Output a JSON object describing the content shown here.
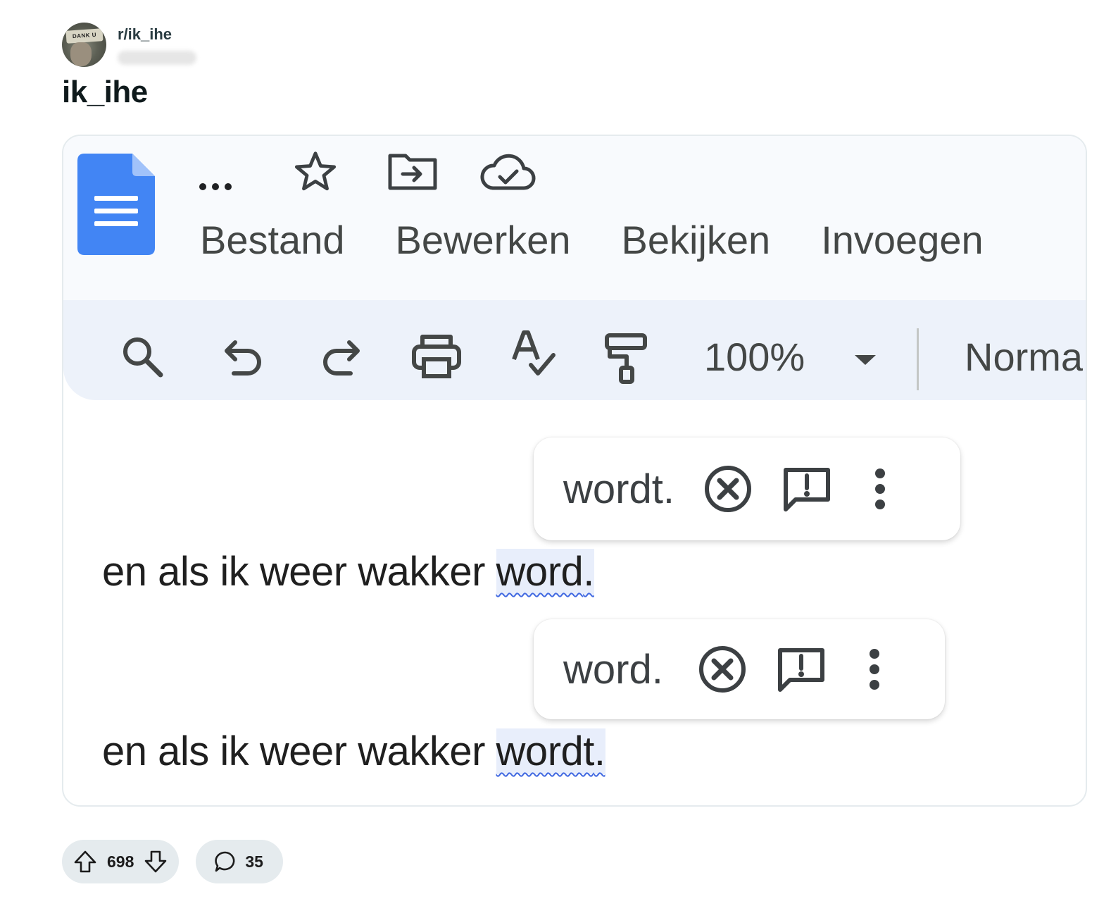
{
  "post": {
    "subreddit": "r/ik_ihe",
    "avatar_text": "DANK U",
    "title": "ik_ihe",
    "upvotes": "698",
    "comments": "35"
  },
  "docs": {
    "menu": [
      "Bestand",
      "Bewerken",
      "Bekijken",
      "Invoegen"
    ],
    "top_icons": [
      "more-dots-icon",
      "star-icon",
      "move-folder-icon",
      "cloud-saved-icon"
    ],
    "toolbar": {
      "icons": [
        "search-icon",
        "undo-icon",
        "redo-icon",
        "print-icon",
        "spellcheck-icon",
        "paint-format-icon"
      ],
      "zoom": "100%",
      "style": "Norma"
    },
    "lines": [
      {
        "prefix": "en als ik weer wakker ",
        "word": "word",
        "suffix": "."
      },
      {
        "prefix": "en als ik weer wakker ",
        "word": "wordt",
        "suffix": "."
      }
    ],
    "suggestions": [
      {
        "text": "wordt."
      },
      {
        "text": "word."
      }
    ],
    "colors": {
      "docs_blue": "#4285f4",
      "toolbar_bg": "#edf2fa",
      "squiggle": "#4169e1"
    }
  }
}
